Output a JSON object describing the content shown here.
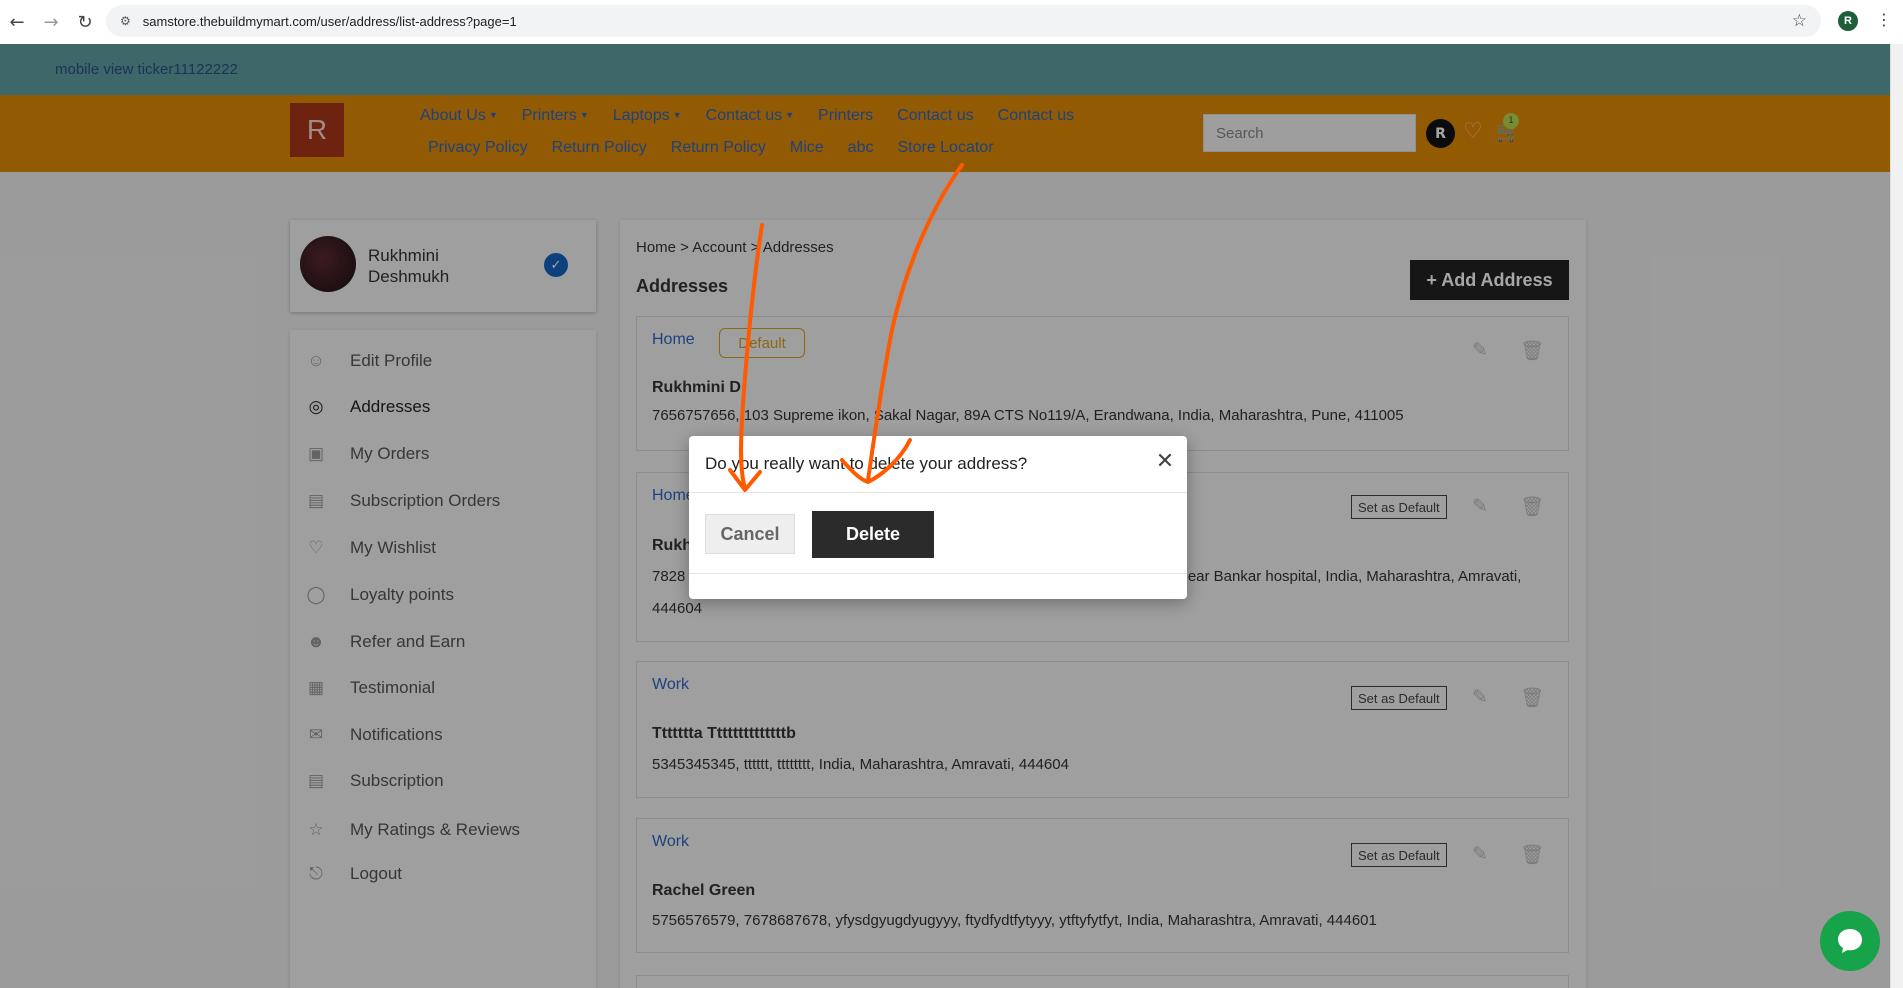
{
  "browser": {
    "url": "samstore.thebuildmymart.com/user/address/list-address?page=1",
    "profile_initial": "R",
    "icons": [
      "back-arrow-icon",
      "forward-arrow-icon",
      "reload-icon",
      "site-settings-icon",
      "bookmark-star-icon",
      "kebab-menu-icon"
    ]
  },
  "ticker": {
    "text": "mobile view ticker11122222"
  },
  "header": {
    "logo_letter": "R",
    "menu_row1": [
      {
        "label": "About Us",
        "has_caret": true
      },
      {
        "label": "Printers",
        "has_caret": true
      },
      {
        "label": "Laptops",
        "has_caret": true
      },
      {
        "label": "Contact us",
        "has_caret": true
      },
      {
        "label": "Printers",
        "has_caret": false
      },
      {
        "label": "Contact us",
        "has_caret": false
      },
      {
        "label": "Contact us",
        "has_caret": false
      }
    ],
    "menu_row2": [
      "Privacy Policy",
      "Return Policy",
      "Return Policy",
      "Mice",
      "abc",
      "Store Locator"
    ],
    "search_placeholder": "Search",
    "user_initial": "R",
    "cart_count": "1"
  },
  "profile": {
    "name_line1": "Rukhmini",
    "name_line2": "Deshmukh"
  },
  "sidebar": {
    "items": [
      {
        "label": "Edit Profile",
        "icon": "user-icon"
      },
      {
        "label": "Addresses",
        "icon": "location-pin-icon",
        "active": true
      },
      {
        "label": "My Orders",
        "icon": "orders-icon"
      },
      {
        "label": "Subscription Orders",
        "icon": "subscription-orders-icon"
      },
      {
        "label": "My Wishlist",
        "icon": "heart-icon"
      },
      {
        "label": "Loyalty points",
        "icon": "coins-icon"
      },
      {
        "label": "Refer and Earn",
        "icon": "refer-user-icon"
      },
      {
        "label": "Testimonial",
        "icon": "testimonial-icon"
      },
      {
        "label": "Notifications",
        "icon": "notification-mail-icon"
      },
      {
        "label": "Subscription",
        "icon": "subscription-icon"
      },
      {
        "label": "My Ratings & Reviews",
        "icon": "star-rating-icon"
      },
      {
        "label": "Logout",
        "icon": "logout-icon"
      }
    ]
  },
  "main": {
    "breadcrumb": "Home > Account > Addresses",
    "title": "Addresses",
    "add_button": "+ Add Address",
    "addresses": [
      {
        "type": "Home",
        "badge": "Default",
        "name": "Rukhmini D",
        "line": "7656757656, 103 Supreme ikon, Sakal Nagar, 89A CTS No119/A, Erandwana, India, Maharashtra, Pune, 411005"
      },
      {
        "type": "Home",
        "set_default": "Set as Default",
        "name": "Rukh",
        "line_start": "7828",
        "line_end": "Near Bankar hospital, India, Maharashtra, Amravati,",
        "line2": "444604"
      },
      {
        "type": "Work",
        "set_default": "Set as Default",
        "name": "Ttttttta Ttttttttttttttb",
        "line": "5345345345, tttttt, tttttttt, India, Maharashtra, Amravati, 444604"
      },
      {
        "type": "Work",
        "set_default": "Set as Default",
        "name": "Rachel Green",
        "line": "5756576579, 7678687678, yfysdgyugdyugyyy, ftydfydtfytyyy, ytftyfytfyt, India, Maharashtra, Amravati, 444601"
      }
    ]
  },
  "modal": {
    "title": "Do you really want to delete your address?",
    "cancel": "Cancel",
    "delete": "Delete"
  },
  "colors": {
    "ticker_bg": "#5f9ea0",
    "header_bg": "#e08a06",
    "link_blue": "#2e66c4",
    "annotation_orange": "#ff5a00",
    "chat_green": "#17a34a"
  }
}
